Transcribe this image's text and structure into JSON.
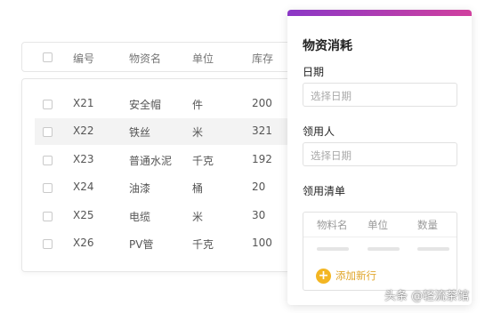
{
  "table": {
    "headers": [
      "编号",
      "物资名",
      "单位",
      "库存"
    ],
    "rows": [
      {
        "id": "X21",
        "name": "安全帽",
        "unit": "件",
        "stock": "200"
      },
      {
        "id": "X22",
        "name": "铁丝",
        "unit": "米",
        "stock": "321"
      },
      {
        "id": "X23",
        "name": "普通水泥",
        "unit": "千克",
        "stock": "192"
      },
      {
        "id": "X24",
        "name": "油漆",
        "unit": "桶",
        "stock": "20"
      },
      {
        "id": "X25",
        "name": "电缆",
        "unit": "米",
        "stock": "30"
      },
      {
        "id": "X26",
        "name": "PV管",
        "unit": "千克",
        "stock": "100"
      }
    ]
  },
  "panel": {
    "title": "物资消耗",
    "accent_gradient": [
      "#8b38c6",
      "#d0409e"
    ],
    "date": {
      "label": "日期",
      "placeholder": "选择日期"
    },
    "recipient": {
      "label": "领用人",
      "placeholder": "选择日期"
    },
    "list": {
      "label": "领用清单",
      "headers": [
        "物料名",
        "单位",
        "数量"
      ],
      "add_label": "添加新行",
      "add_icon": "plus-icon",
      "add_color": "#f3b623"
    }
  },
  "watermark": "头条 @轻流茶馆"
}
